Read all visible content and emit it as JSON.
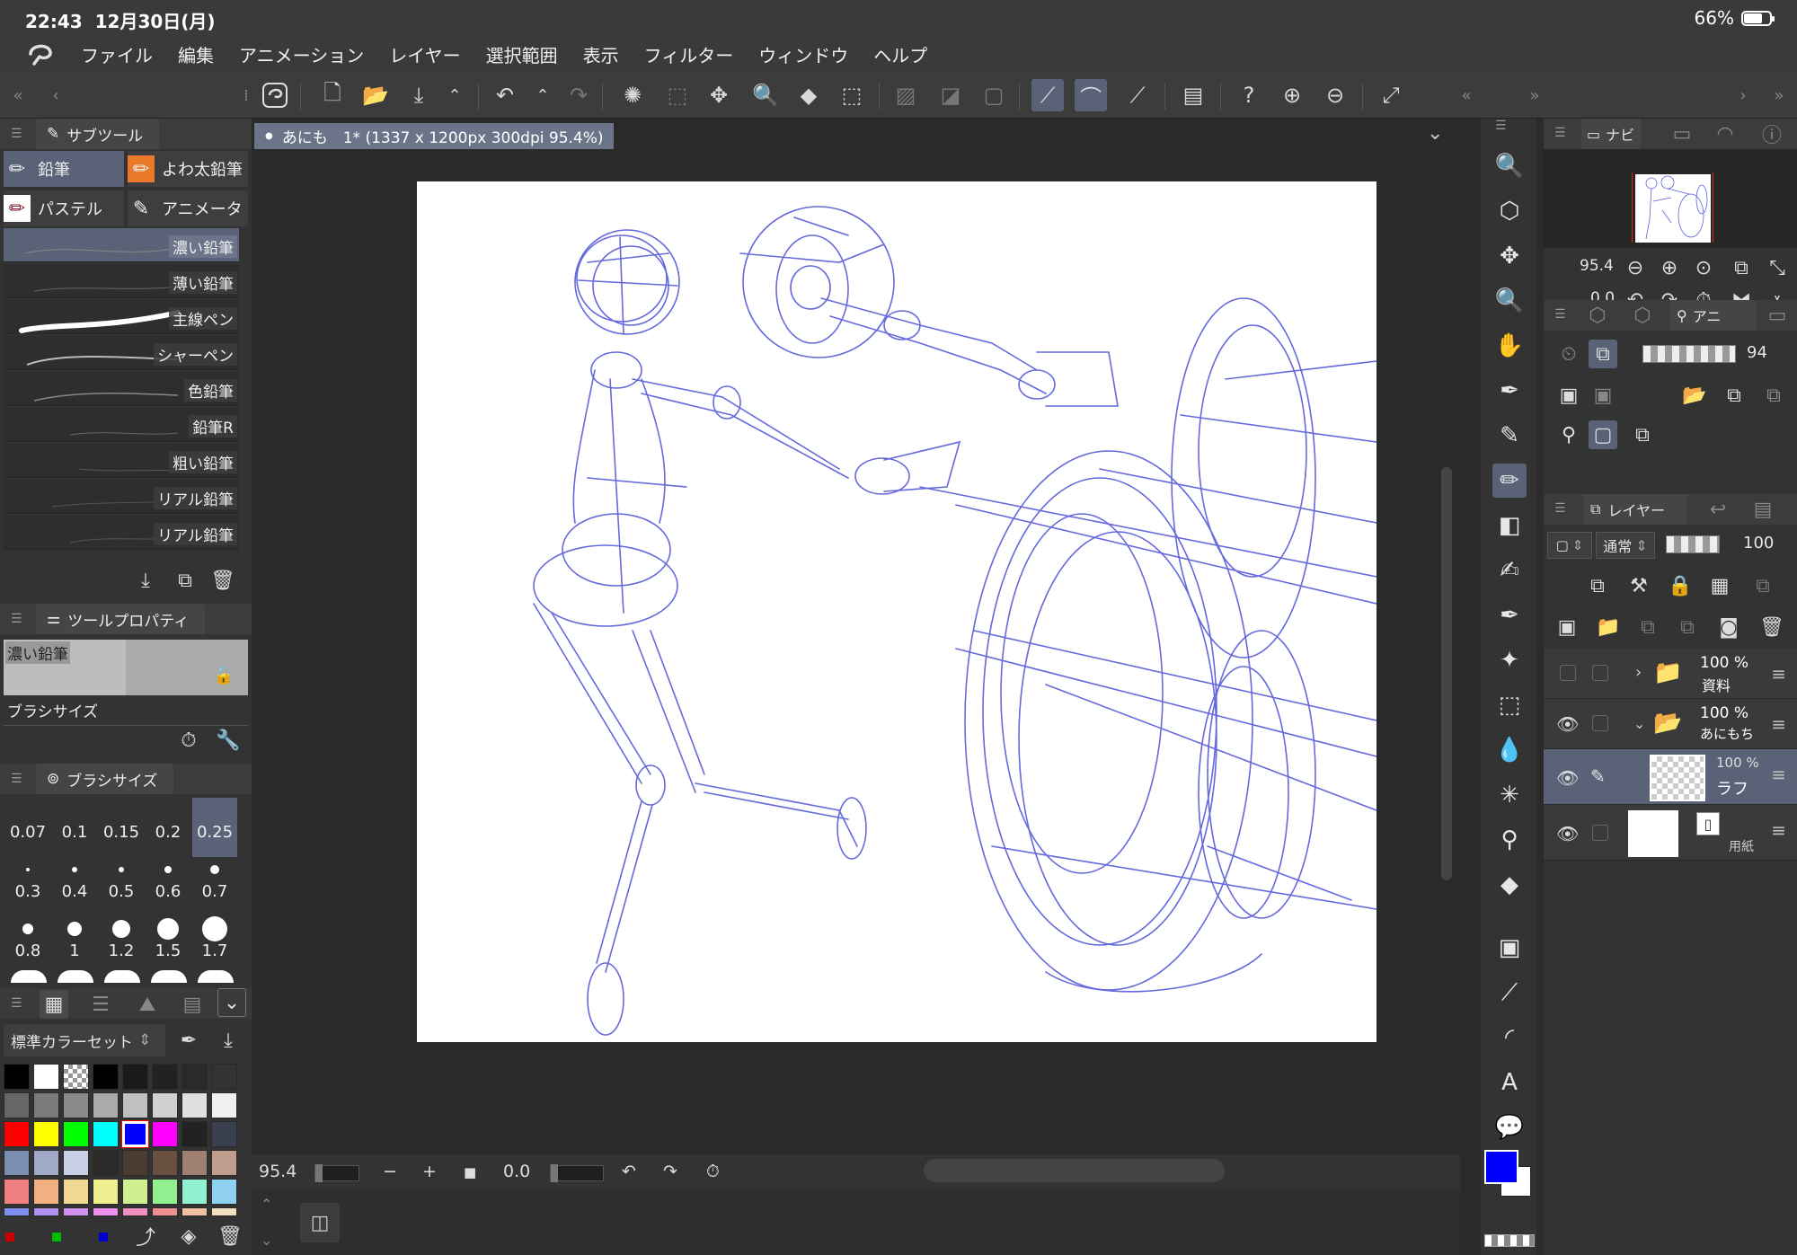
{
  "status": {
    "time": "22:43",
    "date": "12月30日(月)",
    "battery": "66%",
    "battery_level": 0.66
  },
  "menu": [
    "ファイル",
    "編集",
    "アニメーション",
    "レイヤー",
    "選択範囲",
    "表示",
    "フィルター",
    "ウィンドウ",
    "ヘルプ"
  ],
  "document": {
    "tab_label": "あにも　1* (1337 x 1200px 300dpi 95.4%)"
  },
  "subtool": {
    "panel_title": "サブツール",
    "groups": [
      "鉛筆",
      "よわ太鉛筆",
      "パステル",
      "アニメータ"
    ],
    "brushes": [
      "濃い鉛筆",
      "薄い鉛筆",
      "主線ペン",
      "シャーペン",
      "色鉛筆",
      "鉛筆R",
      "粗い鉛筆",
      "リアル鉛筆",
      "リアル鉛筆"
    ]
  },
  "tool_property": {
    "panel_title": "ツールプロパティ",
    "current": "濃い鉛筆",
    "brush_size_label": "ブラシサイズ"
  },
  "brush_size": {
    "panel_title": "ブラシサイズ",
    "sizes": [
      "0.07",
      "0.1",
      "0.15",
      "0.2",
      "0.25",
      "0.3",
      "0.4",
      "0.5",
      "0.6",
      "0.7",
      "0.8",
      "1",
      "1.2",
      "1.5",
      "1.7"
    ],
    "selected": "0.25"
  },
  "color_set": {
    "name": "標準カラーセット"
  },
  "navigator": {
    "tab_label": "ナビ",
    "zoom": "95.4",
    "rotation": "0.0"
  },
  "layer_property": {
    "tab_label": "アニ",
    "opacity": "94"
  },
  "layers_panel": {
    "tab_label": "レイヤー",
    "blend_mode": "通常",
    "opacity": "100",
    "layers": [
      {
        "percent": "100 %",
        "name": "資料",
        "type": "folder"
      },
      {
        "percent": "100 %",
        "name": "あにもち",
        "type": "folder"
      },
      {
        "percent": "100 %",
        "name": "ラフ",
        "type": "raster"
      },
      {
        "percent": "",
        "name": "用紙",
        "type": "paper"
      }
    ]
  },
  "canvas_bottom": {
    "zoom": "95.4",
    "rotation": "0.0"
  },
  "colors": {
    "main": "#0000ff",
    "sub": "#ffffff",
    "accent": "#596277",
    "sketch": "#4a4fd6"
  }
}
